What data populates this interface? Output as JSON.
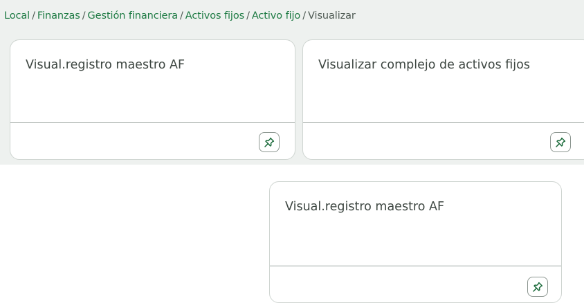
{
  "breadcrumb": {
    "items": [
      "Local",
      "Finanzas",
      "Gestión financiera",
      "Activos fijos",
      "Activo fijo"
    ],
    "current": "Visualizar",
    "separator": "/"
  },
  "tiles": [
    {
      "title": "Visual.registro maestro AF",
      "pin_icon": "pin-icon"
    },
    {
      "title": "Visualizar complejo de activos fijos",
      "pin_icon": "pin-icon"
    },
    {
      "title": "Visual.registro maestro AF",
      "pin_icon": "pin-icon"
    }
  ],
  "colors": {
    "link": "#1d7a43",
    "text": "#3d4641",
    "panel_bg": "#eef1ef",
    "pin": "#1a6a3a"
  }
}
